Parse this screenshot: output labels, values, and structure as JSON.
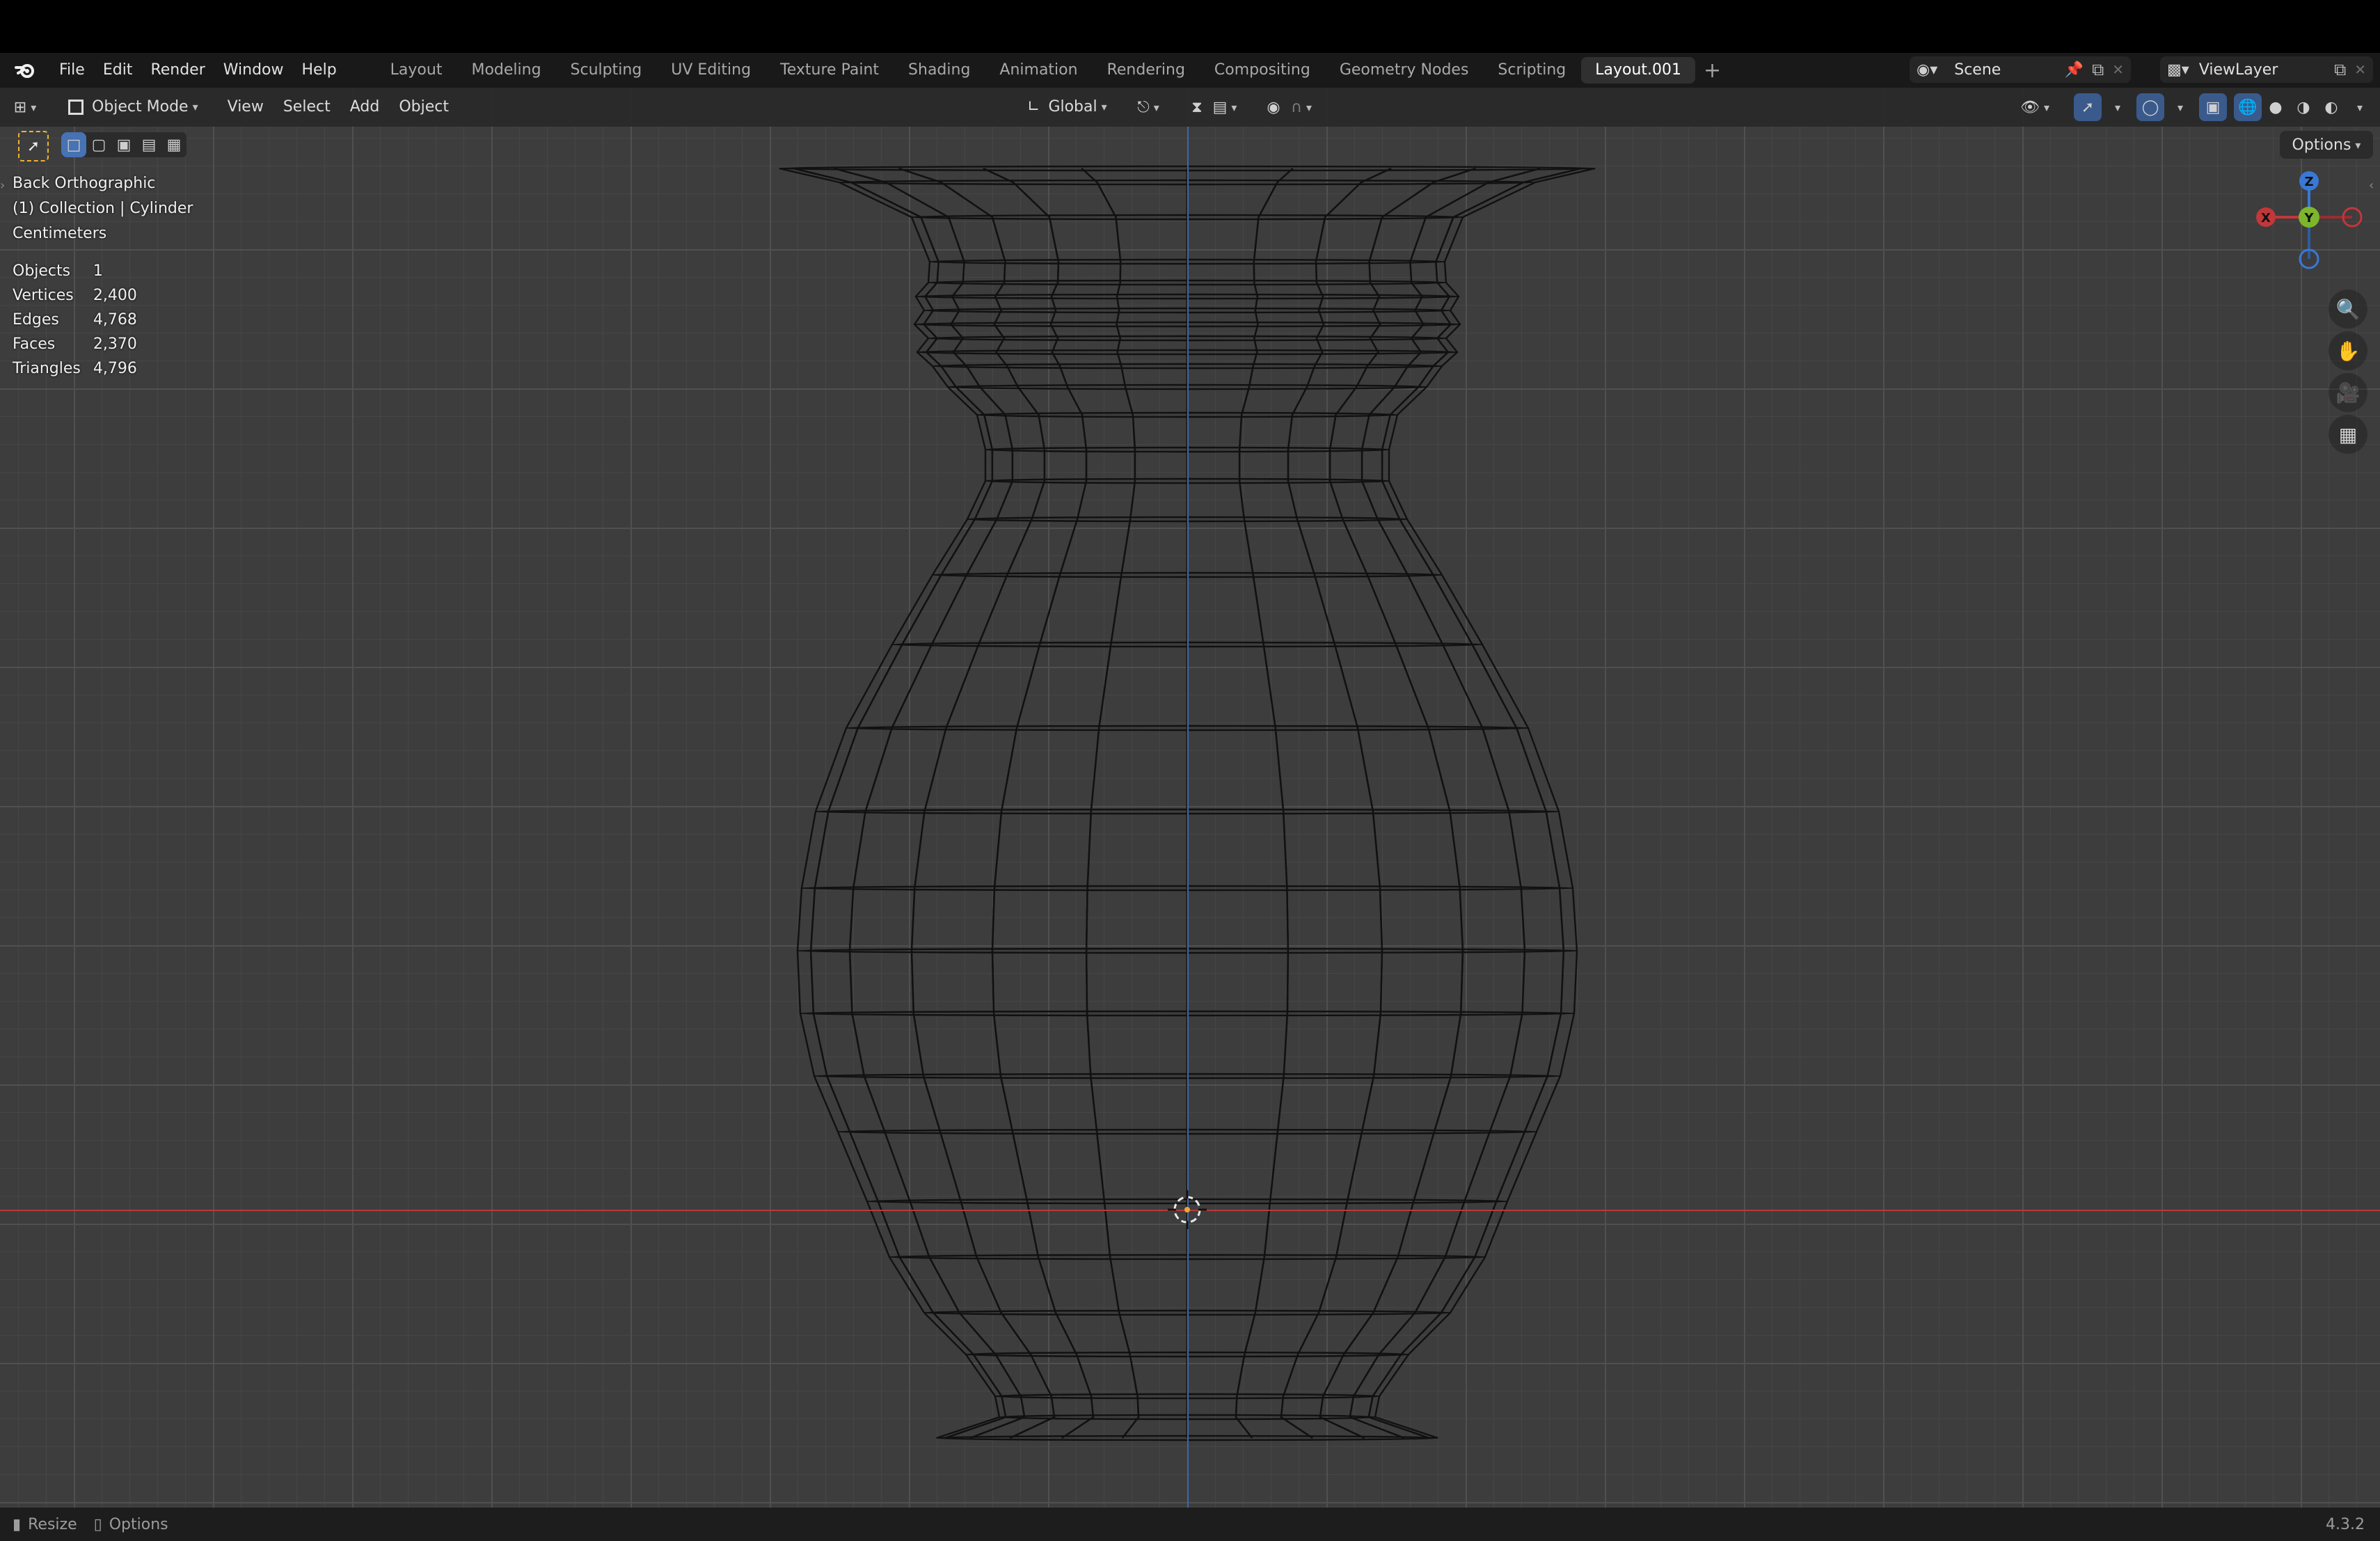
{
  "menu": [
    "File",
    "Edit",
    "Render",
    "Window",
    "Help"
  ],
  "workspaces": [
    "Layout",
    "Modeling",
    "Sculpting",
    "UV Editing",
    "Texture Paint",
    "Shading",
    "Animation",
    "Rendering",
    "Compositing",
    "Geometry Nodes",
    "Scripting",
    "Layout.001"
  ],
  "active_workspace_index": 11,
  "scene_name": "Scene",
  "view_layer": "ViewLayer",
  "viewport_header": {
    "mode": "Object Mode",
    "menus": [
      "View",
      "Select",
      "Add",
      "Object"
    ],
    "transform_orientation": "Global",
    "options_label": "Options"
  },
  "overlay": {
    "view_name": "Back Orthographic",
    "collection_line": "(1) Collection | Cylinder",
    "units": "Centimeters"
  },
  "stats": [
    {
      "label": "Objects",
      "value": "1"
    },
    {
      "label": "Vertices",
      "value": "2,400"
    },
    {
      "label": "Edges",
      "value": "4,768"
    },
    {
      "label": "Faces",
      "value": "2,370"
    },
    {
      "label": "Triangles",
      "value": "4,796"
    }
  ],
  "gizmo": {
    "z": "Z",
    "y": "Y",
    "x": "X"
  },
  "statusbar": {
    "resize": "Resize",
    "options": "Options",
    "version": "4.3.2"
  },
  "colors": {
    "x_axis": "#c2373a",
    "y_axis": "#7db52d",
    "z_axis": "#3a78d6",
    "origin": "#f4a23b"
  }
}
